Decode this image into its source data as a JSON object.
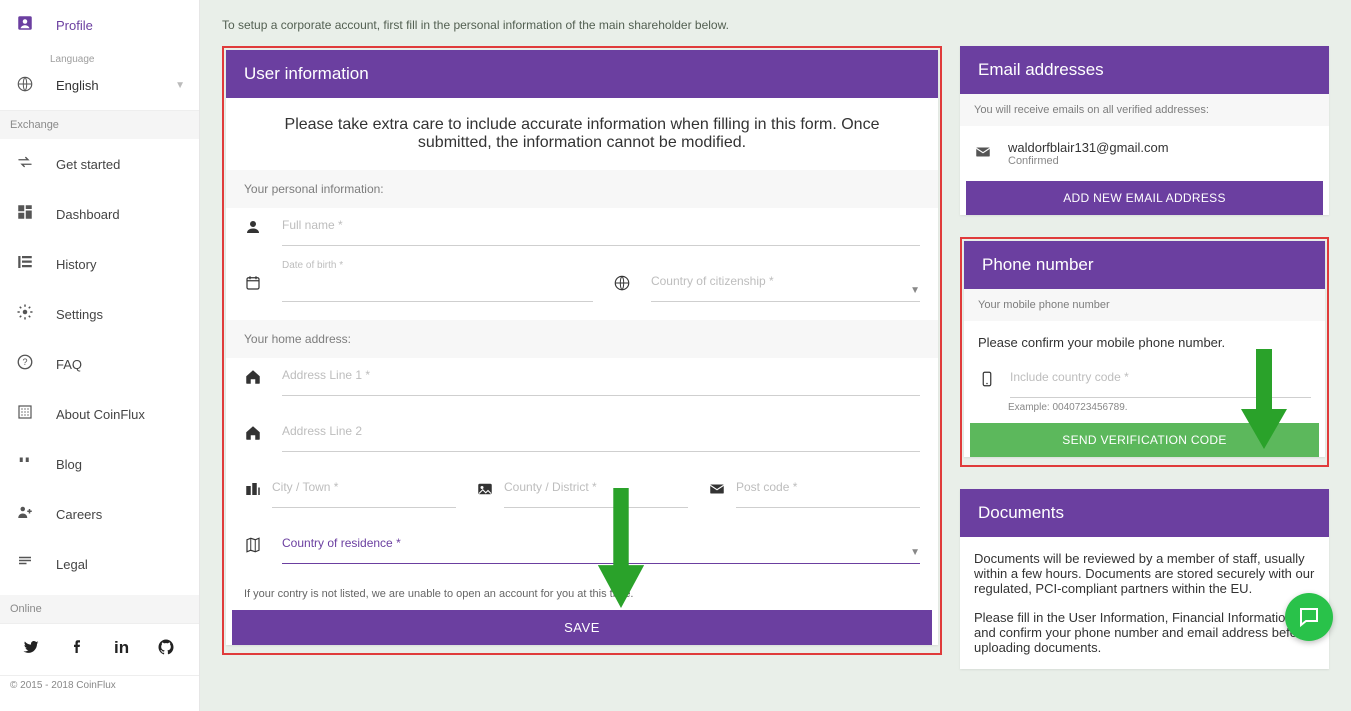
{
  "sidebar": {
    "profile": "Profile",
    "language_label": "Language",
    "language_value": "English",
    "exchange_label": "Exchange",
    "items": [
      {
        "label": "Get started"
      },
      {
        "label": "Dashboard"
      },
      {
        "label": "History"
      },
      {
        "label": "Settings"
      },
      {
        "label": "FAQ"
      },
      {
        "label": "About CoinFlux"
      },
      {
        "label": "Blog"
      },
      {
        "label": "Careers"
      },
      {
        "label": "Legal"
      }
    ],
    "online_label": "Online",
    "copyright": "© 2015 - 2018 CoinFlux"
  },
  "instruction": "To setup a corporate account, first fill in the personal information of the main shareholder below.",
  "user_info": {
    "header": "User information",
    "note": "Please take extra care to include accurate information when filling in this form. Once submitted, the information cannot be modified.",
    "section_personal": "Your personal information:",
    "full_name_label": "Full name",
    "dob_label": "Date of birth",
    "citizenship_label": "Country of citizenship",
    "section_address": "Your home address:",
    "addr1_label": "Address Line 1",
    "addr2_label": "Address Line 2",
    "city_label": "City / Town",
    "county_label": "County / District",
    "postcode_label": "Post code",
    "residence_label": "Country of residence",
    "footnote": "If your contry is not listed, we are unable to open an account for you at this time.",
    "save": "SAVE"
  },
  "emails": {
    "header": "Email addresses",
    "note": "You will receive emails on all verified addresses:",
    "address": "waldorfblair131@gmail.com",
    "status": "Confirmed",
    "add_btn": "ADD NEW EMAIL ADDRESS"
  },
  "phone": {
    "header": "Phone number",
    "note": "Your mobile phone number",
    "body": "Please confirm your mobile phone number.",
    "field_label": "Include country code",
    "example": "Example: 0040723456789.",
    "send_btn": "SEND VERIFICATION CODE"
  },
  "documents": {
    "header": "Documents",
    "p1": "Documents will be reviewed by a member of staff, usually within a few hours. Documents are stored securely with our regulated, PCI-compliant partners within the EU.",
    "p2": "Please fill in the User Information, Financial Information, and confirm your phone number and email address before uploading documents."
  }
}
